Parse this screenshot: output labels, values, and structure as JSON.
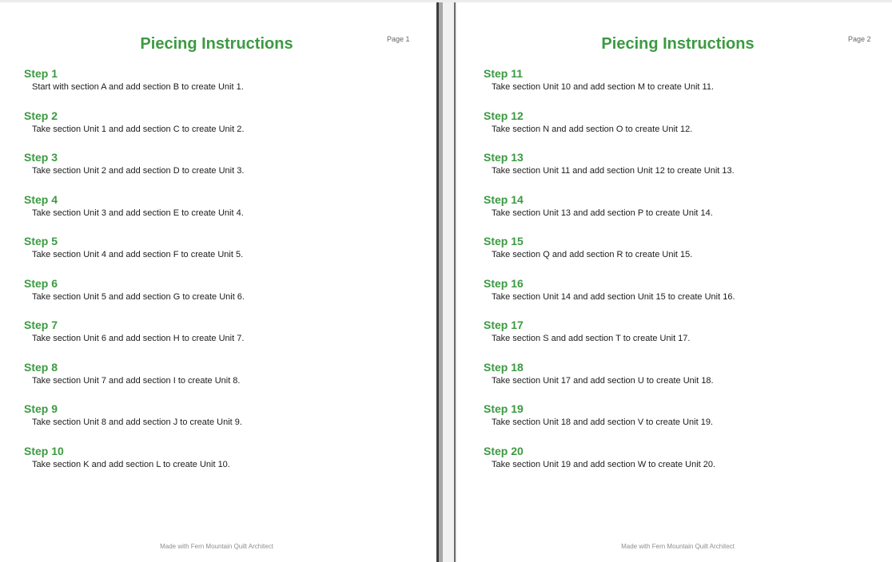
{
  "colors": {
    "heading_green": "#3c9a42",
    "body_text": "#1c1c1c",
    "footer_text": "#8e8e8e",
    "page_number_text": "#666666"
  },
  "pages": [
    {
      "title": "Piecing Instructions",
      "page_label": "Page 1",
      "footer": "Made with Fern Mountain Quilt Architect",
      "steps": [
        {
          "heading": "Step 1",
          "text": "Start with section A and add section B to create Unit 1."
        },
        {
          "heading": "Step 2",
          "text": "Take section Unit 1 and add section C to create Unit 2."
        },
        {
          "heading": "Step 3",
          "text": "Take section Unit 2 and add section D to create Unit 3."
        },
        {
          "heading": "Step 4",
          "text": "Take section Unit 3 and add section E to create Unit 4."
        },
        {
          "heading": "Step 5",
          "text": "Take section Unit 4 and add section F to create Unit 5."
        },
        {
          "heading": "Step 6",
          "text": "Take section Unit 5 and add section G to create Unit 6."
        },
        {
          "heading": "Step 7",
          "text": "Take section Unit 6 and add section H to create Unit 7."
        },
        {
          "heading": "Step 8",
          "text": "Take section Unit 7 and add section I to create Unit 8."
        },
        {
          "heading": "Step 9",
          "text": "Take section Unit 8 and add section J to create Unit 9."
        },
        {
          "heading": "Step 10",
          "text": "Take section K and add section L to create Unit 10."
        }
      ]
    },
    {
      "title": "Piecing Instructions",
      "page_label": "Page 2",
      "footer": "Made with Fern Mountain Quilt Architect",
      "steps": [
        {
          "heading": "Step 11",
          "text": "Take section Unit 10 and add section M to create Unit 11."
        },
        {
          "heading": "Step 12",
          "text": "Take section N and add section O to create Unit 12."
        },
        {
          "heading": "Step 13",
          "text": "Take section Unit 11 and add section Unit 12 to create Unit 13."
        },
        {
          "heading": "Step 14",
          "text": "Take section Unit 13 and add section P to create Unit 14."
        },
        {
          "heading": "Step 15",
          "text": "Take section Q and add section R to create Unit 15."
        },
        {
          "heading": "Step 16",
          "text": "Take section Unit 14 and add section Unit 15 to create Unit 16."
        },
        {
          "heading": "Step 17",
          "text": "Take section S and add section T to create Unit 17."
        },
        {
          "heading": "Step 18",
          "text": "Take section Unit 17 and add section U to create Unit 18."
        },
        {
          "heading": "Step 19",
          "text": "Take section Unit 18 and add section V to create Unit 19."
        },
        {
          "heading": "Step 20",
          "text": "Take section Unit 19 and add section W to create Unit 20."
        }
      ]
    }
  ]
}
